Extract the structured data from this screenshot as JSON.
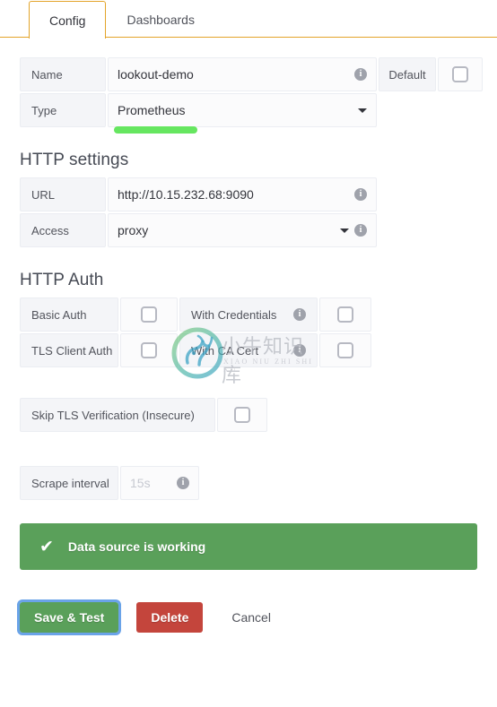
{
  "tabs": [
    {
      "label": "Config",
      "active": true
    },
    {
      "label": "Dashboards",
      "active": false
    }
  ],
  "form": {
    "name": {
      "label": "Name",
      "value": "lookout-demo",
      "info_icon": "info-icon",
      "default_label": "Default",
      "default_checked": false
    },
    "type": {
      "label": "Type",
      "value": "Prometheus",
      "caret_icon": "chevron-down-icon",
      "highlight_color": "#66e660"
    }
  },
  "http_settings": {
    "heading": "HTTP settings",
    "url": {
      "label": "URL",
      "value": "http://10.15.232.68:9090",
      "info_icon": "info-icon"
    },
    "access": {
      "label": "Access",
      "value": "proxy",
      "caret_icon": "chevron-down-icon",
      "info_icon": "info-icon"
    }
  },
  "http_auth": {
    "heading": "HTTP Auth",
    "rows": [
      {
        "left_label": "Basic Auth",
        "left_checked": false,
        "right_label": "With Credentials",
        "right_checked": false,
        "right_info_icon": "info-icon"
      },
      {
        "left_label": "TLS Client Auth",
        "left_checked": false,
        "right_label": "With CA Cert",
        "right_checked": false,
        "right_info_icon": "info-icon"
      }
    ],
    "skip_tls": {
      "label": "Skip TLS Verification (Insecure)",
      "checked": false
    }
  },
  "scrape": {
    "label": "Scrape interval",
    "placeholder": "15s",
    "value": "",
    "info_icon": "info-icon"
  },
  "alert": {
    "icon": "check-icon",
    "message": "Data source is working",
    "color": "#5aa05a"
  },
  "buttons": {
    "save": "Save & Test",
    "delete": "Delete",
    "cancel": "Cancel",
    "save_color": "#5aa05a",
    "delete_color": "#c4453c",
    "focus_ring_color": "#6aa3e8"
  },
  "watermark": {
    "main_text": "小牛知识库",
    "sub_text": "XIAO NIU ZHI SHI KU",
    "logo_icon": "ox-head-logo-icon"
  }
}
